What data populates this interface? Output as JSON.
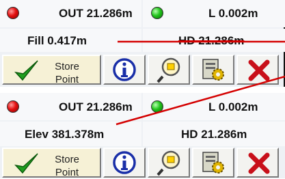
{
  "panels": [
    {
      "row1": {
        "left_label": "OUT 21.286m",
        "right_label": "L 0.002m"
      },
      "row2": {
        "left_label": "Fill 0.417m",
        "right_label": "HD 21.286m"
      },
      "buttons": {
        "store_line1": "Store",
        "store_line2": "Point"
      }
    },
    {
      "row1": {
        "left_label": "OUT 21.286m",
        "right_label": "L 0.002m"
      },
      "row2": {
        "left_label": "Elev 381.378m",
        "right_label": "HD 21.286m"
      },
      "buttons": {
        "store_line1": "Store",
        "store_line2": "Point"
      }
    }
  ],
  "colors": {
    "status_left": "#e31010",
    "status_right": "#22c41c",
    "annotation_line": "#d40000",
    "cancel_x": "#c8101a",
    "checkmark": "#1f9e1f",
    "info_blue": "#1a2fa8"
  },
  "icons": [
    "red-status-icon",
    "green-status-icon",
    "checkmark-icon",
    "info-icon",
    "search-icon",
    "settings-icon",
    "cancel-icon"
  ]
}
